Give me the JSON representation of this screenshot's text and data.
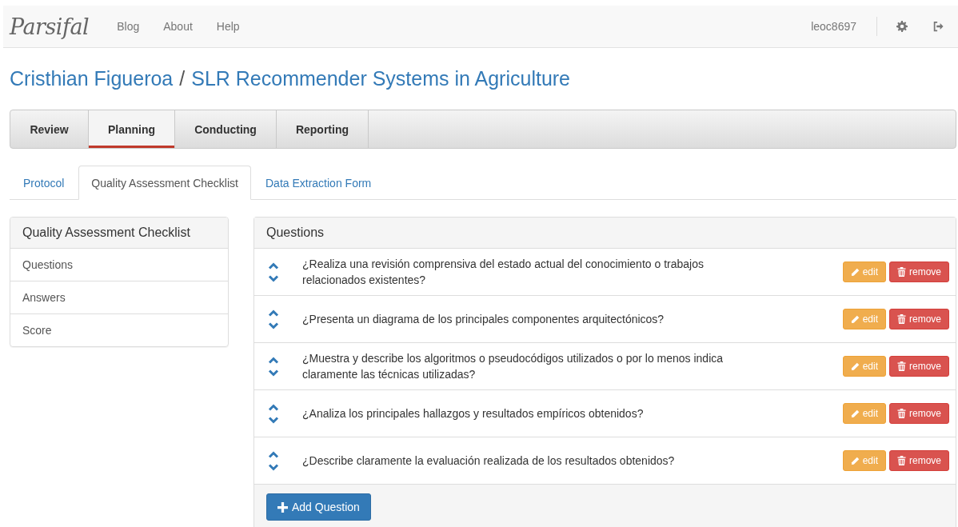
{
  "navbar": {
    "brand": "Parsifal",
    "links": [
      "Blog",
      "About",
      "Help"
    ],
    "user": "leoc8697"
  },
  "breadcrumb": {
    "owner": "Cristhian Figueroa",
    "separator": "/",
    "review": "SLR Recommender Systems in Agriculture"
  },
  "main_tabs": [
    {
      "label": "Review",
      "selected": false
    },
    {
      "label": "Planning",
      "selected": true
    },
    {
      "label": "Conducting",
      "selected": false
    },
    {
      "label": "Reporting",
      "selected": false
    }
  ],
  "sub_tabs": [
    {
      "label": "Protocol",
      "selected": false
    },
    {
      "label": "Quality Assessment Checklist",
      "selected": true
    },
    {
      "label": "Data Extraction Form",
      "selected": false
    }
  ],
  "sidebar": {
    "title": "Quality Assessment Checklist",
    "items": [
      "Questions",
      "Answers",
      "Score"
    ]
  },
  "questions_panel": {
    "title": "Questions",
    "questions": [
      {
        "text": "¿Realiza una revisión comprensiva del estado actual del conocimiento o trabajos relacionados existentes?",
        "edit": "edit",
        "remove": "remove"
      },
      {
        "text": "¿Presenta un diagrama de los principales componentes arquitectónicos?",
        "edit": "edit",
        "remove": "remove"
      },
      {
        "text": "¿Muestra y describe los algoritmos o pseudocódigos utilizados o por lo menos indica claramente las técnicas utilizadas?",
        "edit": "edit",
        "remove": "remove"
      },
      {
        "text": "¿Analiza los principales hallazgos y resultados empíricos obtenidos?",
        "edit": "edit",
        "remove": "remove"
      },
      {
        "text": "¿Describe claramente la evaluación realizada de los resultados obtenidos?",
        "edit": "edit",
        "remove": "remove"
      }
    ],
    "add_button": "Add Question"
  }
}
